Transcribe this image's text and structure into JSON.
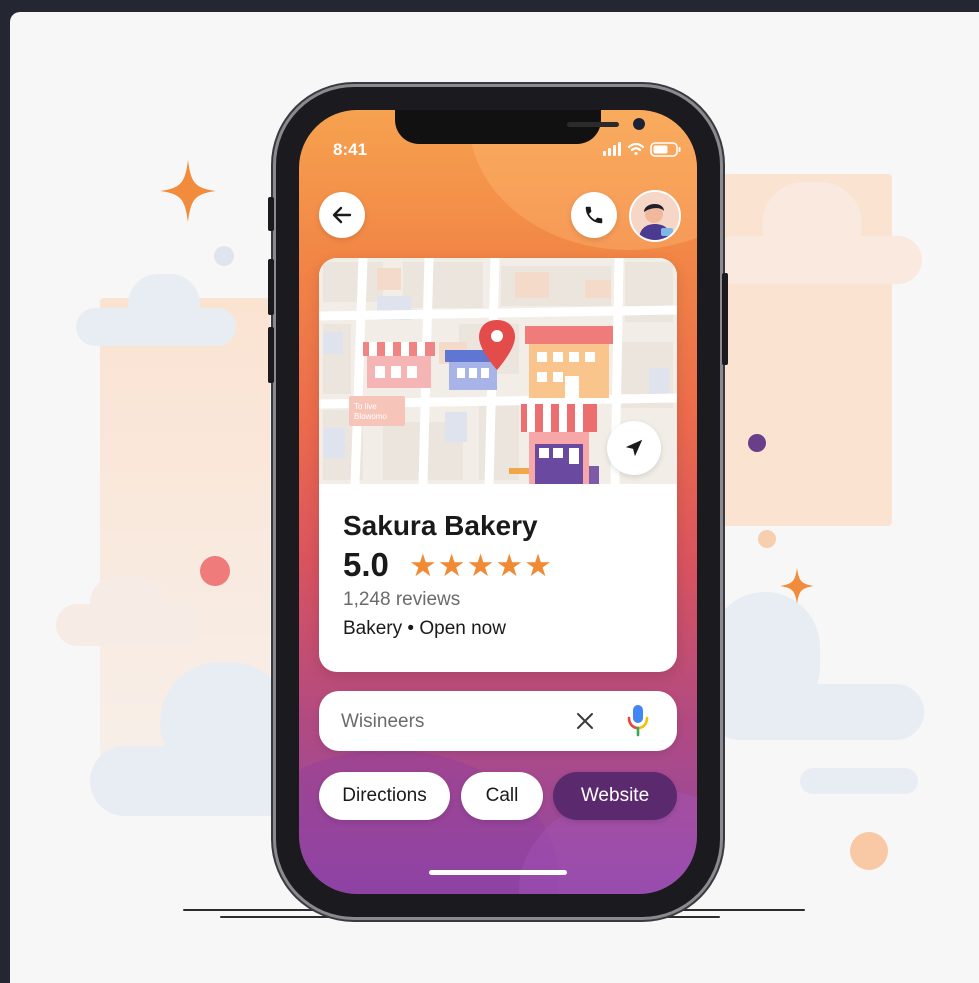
{
  "status_bar": {
    "time": "8:41"
  },
  "header": {
    "back_icon": "arrow-left-icon",
    "call_icon": "phone-icon",
    "avatar_icon": "user-avatar"
  },
  "map": {
    "street_sign": [
      "To live",
      "Blowomo"
    ],
    "pin_icon": "location-pin-icon",
    "recenter_icon": "navigation-arrow-icon"
  },
  "place": {
    "name": "Sakura Bakery",
    "rating": "5.0",
    "stars": "★★★★★",
    "star_count": 5,
    "reviews": "1,248 reviews",
    "category_status": "Bakery • Open now"
  },
  "search": {
    "value": "Wisineers",
    "clear_icon": "close-icon",
    "mic_icon": "microphone-icon"
  },
  "actions": {
    "directions": "Directions",
    "call": "Call",
    "website": "Website"
  },
  "colors": {
    "accent_orange": "#f28746",
    "star_color": "#f08a35",
    "website_button": "#5b2a6e",
    "gradient_bottom": "#8e48a8"
  }
}
